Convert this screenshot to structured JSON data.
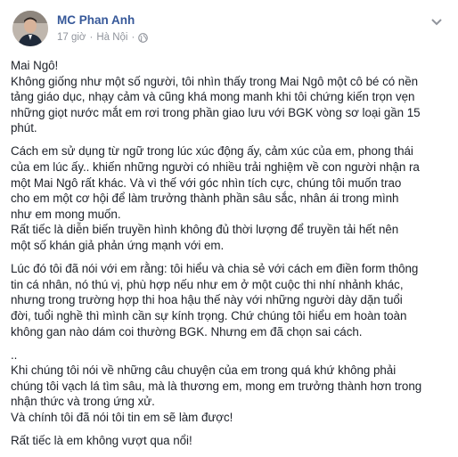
{
  "post": {
    "author": "MC Phan Anh",
    "time": "17 giờ",
    "separator": "·",
    "location": "Hà Nội",
    "separator2": "·"
  },
  "paragraphs": [
    "Mai Ngô!\nKhông giống như một số người, tôi nhìn thấy trong Mai Ngô một cô bé có nền\ntảng giáo dục, nhạy cảm và cũng khá mong manh khi tôi chứng kiến trọn vẹn\nnhững giọt nước mắt em rơi trong phần giao lưu với BGK vòng sơ loại gần 15\nphút.",
    "Cách em sử dụng từ ngữ trong lúc xúc động ấy, cảm xúc của em, phong thái\ncủa em lúc ấy.. khiến những người có nhiều trải nghiệm về con người nhận ra\nmột Mai Ngô rất khác. Và vì thế với góc nhìn tích cực, chúng tôi muốn trao\ncho em một cơ hội để làm trưởng thành phần sâu sắc, nhân ái trong mình\nnhư em mong muốn.\nRất tiếc là diễn biến truyền hình không đủ thời lượng để truyền tải hết nên\nmột số khán giả phản ứng mạnh với em.",
    "Lúc đó tôi đã nói với em rằng: tôi hiểu và chia sẻ với cách em điền form thông\ntin cá nhân, nó thú vị, phù hợp nếu như em ở một cuộc thi nhí nhảnh khác,\nnhưng trong trường hợp thi hoa hậu thế này với những người dày dặn tuổi\nđời, tuổi nghề thì mình cần sự kính trọng. Chứ chúng tôi hiểu em hoàn toàn\nkhông gan nào dám coi thường BGK. Nhưng em đã chọn sai cách.",
    "..\nKhi chúng tôi nói về những câu chuyện của em trong quá khứ không phải\nchúng tôi vạch lá tìm sâu, mà là thương em, mong em trưởng thành hơn trong\nnhận thức và trong ứng xử.\nVà chính tôi đã nói tôi tin em sẽ làm được!",
    "Rất tiếc là em không vượt qua nổi!"
  ],
  "icons": {
    "audience": "globe-icon",
    "options": "chevron-down-icon"
  },
  "colors": {
    "author": "#365899",
    "meta": "#90949c",
    "text": "#1d2129"
  }
}
